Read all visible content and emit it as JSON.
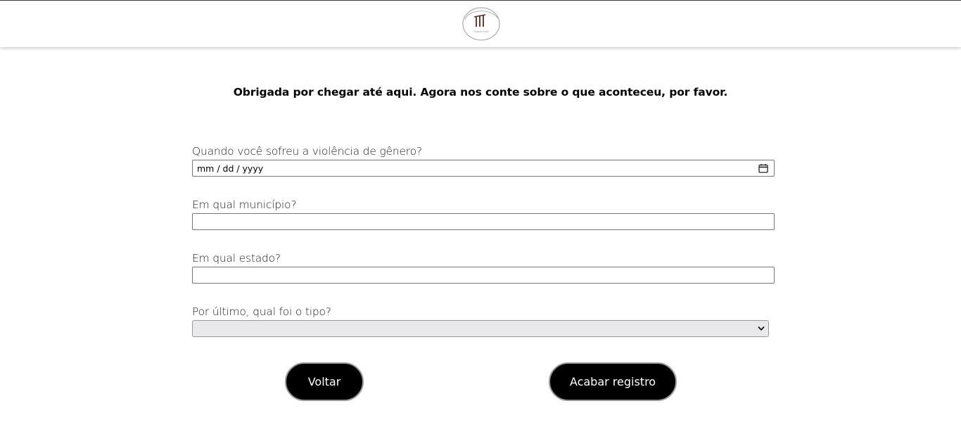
{
  "header": {
    "logo_text": "Track Safe"
  },
  "intro": "Obrigada por chegar até aqui. Agora nos conte sobre o que aconteceu, por favor.",
  "form": {
    "date": {
      "label": "Quando você sofreu a violência de gênero?",
      "placeholder": "mm / dd / yyyy",
      "icon": "calendar-icon"
    },
    "city": {
      "label": "Em qual município?",
      "value": ""
    },
    "state": {
      "label": "Em qual estado?",
      "value": ""
    },
    "type": {
      "label": "Por último, qual foi o tipo?",
      "selected": "",
      "icon": "chevron-down-icon"
    }
  },
  "buttons": {
    "back": "Voltar",
    "finish": "Acabar registro"
  },
  "colors": {
    "button_bg": "#000000",
    "button_text": "#ffffff",
    "select_bg": "#e9e9ed",
    "logo_accent": "#5a2a1e"
  }
}
